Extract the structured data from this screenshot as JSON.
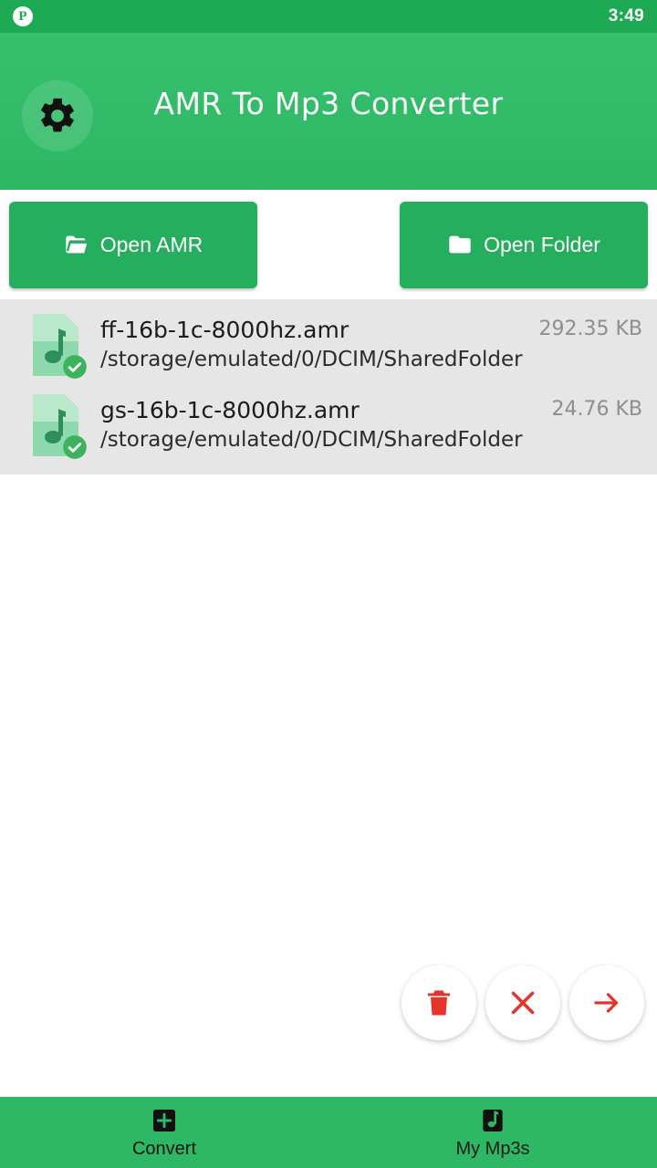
{
  "status": {
    "app_icon": "pinterest-icon",
    "time": "3:49"
  },
  "appbar": {
    "title": "AMR To Mp3 Converter",
    "settings_icon": "gear-icon"
  },
  "actions": {
    "open_amr": {
      "label": "Open AMR",
      "icon": "open-folder-icon"
    },
    "open_folder": {
      "label": "Open Folder",
      "icon": "folder-icon"
    }
  },
  "files": [
    {
      "name": "ff-16b-1c-8000hz.amr",
      "path": "/storage/emulated/0/DCIM/SharedFolder",
      "size": "292.35 KB",
      "selected": true
    },
    {
      "name": "gs-16b-1c-8000hz.amr",
      "path": "/storage/emulated/0/DCIM/SharedFolder",
      "size": "24.76 KB",
      "selected": true
    }
  ],
  "fabs": [
    {
      "name": "delete-button",
      "icon": "trash-icon",
      "color": "#e8332a"
    },
    {
      "name": "clear-button",
      "icon": "close-icon",
      "color": "#e8332a"
    },
    {
      "name": "next-button",
      "icon": "arrow-right-icon",
      "color": "#e8332a"
    }
  ],
  "bottom_nav": [
    {
      "label": "Convert",
      "icon": "convert-icon",
      "active": true
    },
    {
      "label": "My Mp3s",
      "icon": "music-note-icon",
      "active": false
    }
  ],
  "colors": {
    "primary": "#2eb764",
    "status_bar": "#1eaa55",
    "button": "#26ae5f",
    "list_bg": "#e6e6e6",
    "accent_red": "#e8332a",
    "check_green": "#3db35e"
  }
}
